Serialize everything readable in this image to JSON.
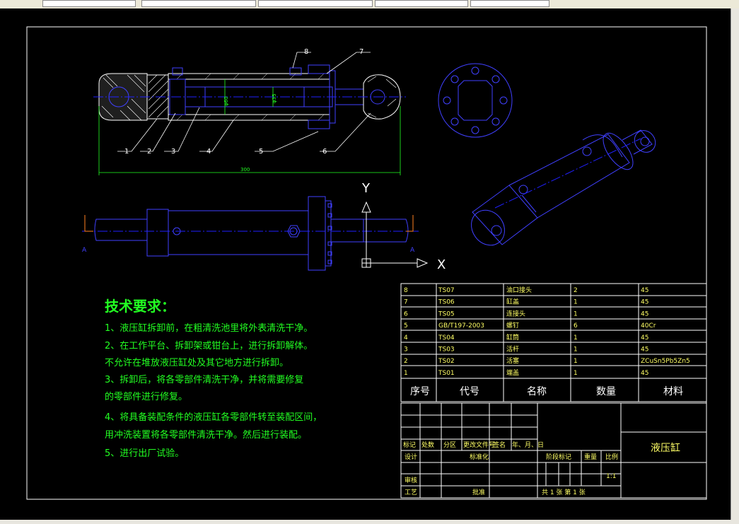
{
  "drawing": {
    "title": "液压缸",
    "dim_total": "300",
    "dim_bore": "φ60",
    "dim_rod": "φ35",
    "axis_x": "X",
    "axis_y": "Y",
    "port_mark": "A",
    "callouts": [
      "1",
      "2",
      "3",
      "4",
      "5",
      "6",
      "7",
      "8"
    ]
  },
  "tech_requirements": {
    "heading": "技术要求：",
    "lines": [
      "1、液压缸拆卸前，在粗清洗池里将外表清洗干净。",
      "2、在工作平台、拆卸架或钳台上，进行拆卸解体。",
      "不允许在堆放液压缸处及其它地方进行拆卸。",
      "3、拆卸后，将各零部件清洗干净，并将需要修复",
      "的零部件进行修复。",
      "4、将具备装配条件的液压缸各零部件转至装配区间，",
      "用冲洗装置将各零部件清洗干净。然后进行装配。",
      "5、进行出厂试验。"
    ]
  },
  "parts_list": {
    "headers": [
      "序号",
      "代号",
      "名称",
      "数量",
      "材料"
    ],
    "rows": [
      [
        "8",
        "TS07",
        "油口接头",
        "2",
        "45"
      ],
      [
        "7",
        "TS06",
        "缸盖",
        "1",
        "45"
      ],
      [
        "6",
        "TS05",
        "连接头",
        "1",
        "45"
      ],
      [
        "5",
        "GB/T197-2003",
        "螺钉",
        "6",
        "40Cr"
      ],
      [
        "4",
        "TS04",
        "缸筒",
        "1",
        "45"
      ],
      [
        "3",
        "TS03",
        "活杆",
        "1",
        "45"
      ],
      [
        "2",
        "TS02",
        "活塞",
        "1",
        "ZCuSn5Pb5Zn5"
      ],
      [
        "1",
        "TS01",
        "端盖",
        "1",
        "45"
      ]
    ]
  },
  "title_block": {
    "labels": [
      "标记",
      "处数",
      "分区",
      "更改文件号",
      "签名",
      "年、月、日"
    ],
    "design": "设计",
    "standard": "标准化",
    "stage": "阶段标记",
    "weight": "重量",
    "scale": "比例",
    "scale_value": "1:1",
    "review": "审核",
    "process": "工艺",
    "approve": "批准",
    "sheets": "共 1 张    第 1 张",
    "name": "液压缸"
  },
  "colors": {
    "background": "#000000",
    "frame": "#ffffff",
    "outline": "#4040ff",
    "centerline": "#2020ff",
    "section": "#ffffff",
    "text_green": "#22ff22",
    "table_text": "#ffff66",
    "table_line": "#ffffff"
  }
}
